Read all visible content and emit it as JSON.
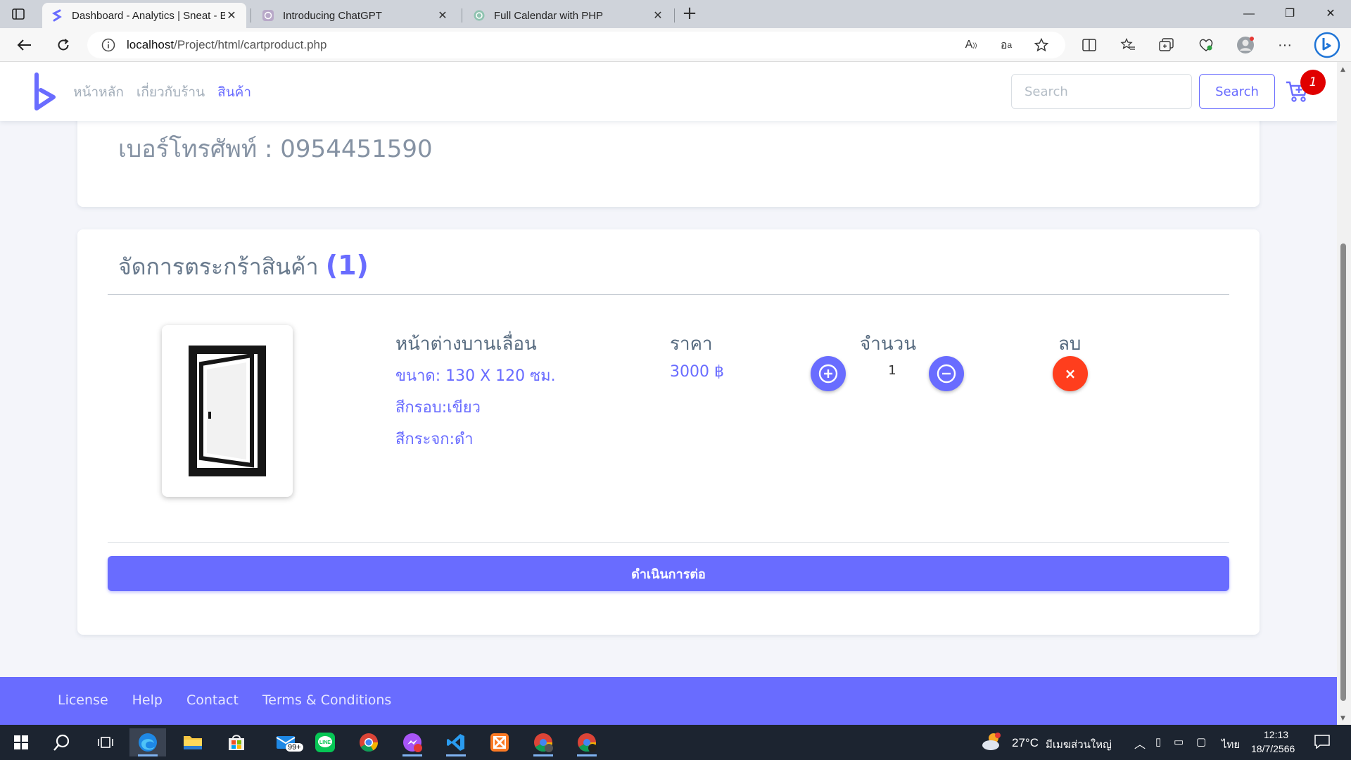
{
  "browser": {
    "tabs": [
      {
        "title": "Dashboard - Analytics | Sneat - B",
        "active": true,
        "favicon": "sneat-icon"
      },
      {
        "title": "Introducing ChatGPT",
        "active": false,
        "favicon": "openai-icon"
      },
      {
        "title": "Full Calendar with PHP",
        "active": false,
        "favicon": "openai-icon"
      }
    ],
    "url_host": "localhost",
    "url_path": "/Project/html/cartproduct.php",
    "read_aloud_label": "A",
    "translate_label": "อ"
  },
  "site": {
    "menu": [
      {
        "label": "หน้าหลัก",
        "active": false
      },
      {
        "label": "เกี่ยวกับร้าน",
        "active": false
      },
      {
        "label": "สินค้า",
        "active": true
      }
    ],
    "search_placeholder": "Search",
    "search_button": "Search",
    "cart_count": "1",
    "accent": "#696cff"
  },
  "contact_card": {
    "phone_text": "เบอร์โทรศัพท์ : 0954451590"
  },
  "cart": {
    "title": "จัดการตระกร้าสินค้า",
    "count": "(1)",
    "item": {
      "name": "หน้าต่างบานเลื่อน",
      "size": "ขนาด: 130 X 120 ซม.",
      "frame_color": "สีกรอบ:เขียว",
      "glass_color": "สีกระจก:ดำ",
      "price_header": "ราคา",
      "price": "3000 ฿",
      "qty_header": "จำนวน",
      "quantity": "1",
      "delete_header": "ลบ",
      "delete_symbol": "×"
    },
    "continue_button": "ดำเนินการต่อ"
  },
  "footer": {
    "links": [
      "License",
      "Help",
      "Contact",
      "Terms & Conditions"
    ]
  },
  "taskbar": {
    "weather": "27°C",
    "weather_text": "มีเมฆส่วนใหญ่",
    "lang": "ไทย",
    "time": "12:13",
    "date": "18/7/2566",
    "mail_badge": "99+"
  }
}
